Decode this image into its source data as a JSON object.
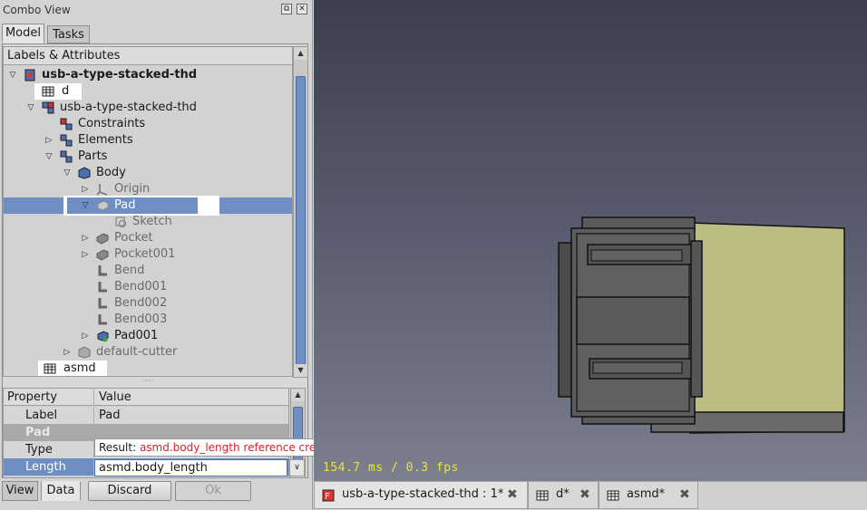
{
  "panel": {
    "title": "Combo View",
    "float_glyph": "⧉",
    "close_glyph": "✕"
  },
  "top_tabs": [
    {
      "label": "Model",
      "active": true
    },
    {
      "label": "Tasks",
      "active": false
    }
  ],
  "tree": {
    "header": "Labels & Attributes",
    "items": [
      {
        "label": "usb-a-type-stacked-thd",
        "icon": "document-icon",
        "arrow": "▽"
      },
      {
        "label": "d",
        "icon": "spreadsheet-icon",
        "arrow": ""
      },
      {
        "label": "usb-a-type-stacked-thd",
        "icon": "assembly-icon",
        "arrow": "▽"
      },
      {
        "label": "Constraints",
        "icon": "constraints-icon",
        "arrow": ""
      },
      {
        "label": "Elements",
        "icon": "elements-icon",
        "arrow": "▷"
      },
      {
        "label": "Parts",
        "icon": "parts-icon",
        "arrow": "▽"
      },
      {
        "label": "Body",
        "icon": "body-icon",
        "arrow": "▽"
      },
      {
        "label": "Origin",
        "icon": "origin-icon",
        "arrow": "▷"
      },
      {
        "label": "Pad",
        "icon": "pad-icon",
        "arrow": "▽"
      },
      {
        "label": "Sketch",
        "icon": "sketch-icon",
        "arrow": ""
      },
      {
        "label": "Pocket",
        "icon": "pocket-icon",
        "arrow": "▷"
      },
      {
        "label": "Pocket001",
        "icon": "pocket-icon",
        "arrow": "▷"
      },
      {
        "label": "Bend",
        "icon": "bend-icon",
        "arrow": ""
      },
      {
        "label": "Bend001",
        "icon": "bend-icon",
        "arrow": ""
      },
      {
        "label": "Bend002",
        "icon": "bend-icon",
        "arrow": ""
      },
      {
        "label": "Bend003",
        "icon": "bend-icon",
        "arrow": ""
      },
      {
        "label": "Pad001",
        "icon": "pad-icon",
        "arrow": "▷"
      },
      {
        "label": "default-cutter",
        "icon": "cutter-icon",
        "arrow": "▷"
      },
      {
        "label": "asmd",
        "icon": "spreadsheet-icon",
        "arrow": ""
      }
    ],
    "selected": "Pad"
  },
  "properties": {
    "header_property": "Property",
    "header_value": "Value",
    "rows": [
      {
        "property": "Label",
        "value": "Pad"
      },
      {
        "property": "Pad",
        "value": ""
      },
      {
        "property": "Type",
        "value": ""
      },
      {
        "property": "Length",
        "value": ""
      }
    ]
  },
  "tooltip": {
    "prefix": "Result: ",
    "message": "asmd.body_length reference creates a cyclic dependency."
  },
  "editor": {
    "value": "asmd.body_length",
    "dropdown_glyph": "∨"
  },
  "bottom_tabs": [
    {
      "label": "View",
      "active": false
    },
    {
      "label": "Data",
      "active": true
    }
  ],
  "buttons": {
    "discard": "Discard",
    "ok": "Ok"
  },
  "view3d": {
    "fps_text": "154.7 ms / 0.3 fps"
  },
  "doc_tabs": [
    {
      "label": "usb-a-type-stacked-thd : 1*",
      "icon": "freecad-icon",
      "active": true
    },
    {
      "label": "d*",
      "icon": "spreadsheet-icon",
      "active": false
    },
    {
      "label": "asmd*",
      "icon": "spreadsheet-icon",
      "active": false
    }
  ],
  "close_glyph": "✖",
  "splitter_glyph": "·····",
  "colors": {
    "selection": "#6f8fc4",
    "error_text": "#e0202a",
    "fps_text": "#e6e63c",
    "part_face": "#bdbc82",
    "part_dark": "#5c5c5c"
  }
}
